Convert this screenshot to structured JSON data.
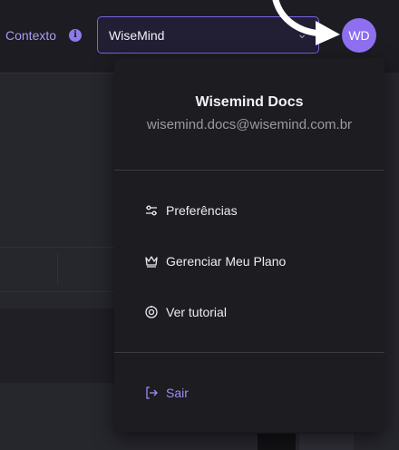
{
  "header": {
    "context_label": "Contexto",
    "info_glyph": "i",
    "context_select": {
      "value": "WiseMind",
      "chevron": "⌄"
    },
    "avatar_initials": "WD"
  },
  "user_menu": {
    "name": "Wisemind Docs",
    "email": "wisemind.docs@wisemind.com.br",
    "items": [
      {
        "label": "Preferências",
        "icon": "sliders-icon"
      },
      {
        "label": "Gerenciar Meu Plano",
        "icon": "crown-icon"
      },
      {
        "label": "Ver tutorial",
        "icon": "compass-icon"
      }
    ],
    "logout": {
      "label": "Sair",
      "icon": "logout-icon"
    }
  },
  "colors": {
    "accent": "#8d6ff0",
    "menu_bg": "#1c1c21",
    "logout": "#9f8cf3"
  }
}
